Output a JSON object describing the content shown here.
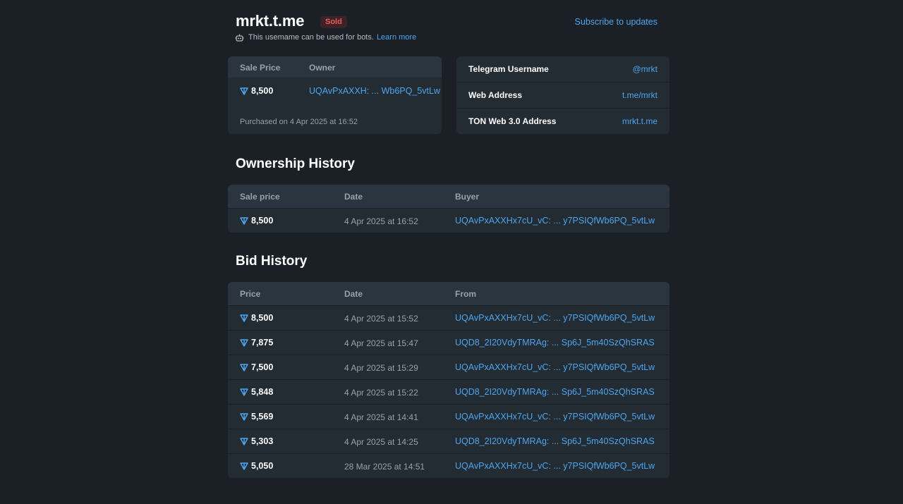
{
  "header": {
    "title": "mrkt.t.me",
    "status_badge": "Sold",
    "subscribe_label": "Subscribe to updates",
    "bot_note": "This usemame can be used for bots.",
    "learn_more": "Learn more"
  },
  "sale_card": {
    "price_header": "Sale Price",
    "owner_header": "Owner",
    "price": "8,500",
    "owner": "UQAvPxAXXH: ... Wb6PQ_5vtLw",
    "purchased": "Purchased on 4 Apr 2025 at 16:52"
  },
  "info_card": {
    "rows": [
      {
        "label": "Telegram Username",
        "value": "@mrkt"
      },
      {
        "label": "Web Address",
        "value": "t.me/mrkt"
      },
      {
        "label": "TON Web 3.0 Address",
        "value": "mrkt.t.me"
      }
    ]
  },
  "ownership": {
    "title": "Ownership History",
    "headers": [
      "Sale price",
      "Date",
      "Buyer"
    ],
    "rows": [
      {
        "price": "8,500",
        "date": "4 Apr 2025 at 16:52",
        "address": "UQAvPxAXXHx7cU_vC: ... y7PSIQfWb6PQ_5vtLw"
      }
    ]
  },
  "bids": {
    "title": "Bid History",
    "headers": [
      "Price",
      "Date",
      "From"
    ],
    "rows": [
      {
        "price": "8,500",
        "date": "4 Apr 2025 at 15:52",
        "address": "UQAvPxAXXHx7cU_vC: ... y7PSIQfWb6PQ_5vtLw"
      },
      {
        "price": "7,875",
        "date": "4 Apr 2025 at 15:47",
        "address": "UQD8_2I20VdyTMRAg: ... Sp6J_5m40SzQhSRAS"
      },
      {
        "price": "7,500",
        "date": "4 Apr 2025 at 15:29",
        "address": "UQAvPxAXXHx7cU_vC: ... y7PSIQfWb6PQ_5vtLw"
      },
      {
        "price": "5,848",
        "date": "4 Apr 2025 at 15:22",
        "address": "UQD8_2I20VdyTMRAg: ... Sp6J_5m40SzQhSRAS"
      },
      {
        "price": "5,569",
        "date": "4 Apr 2025 at 14:41",
        "address": "UQAvPxAXXHx7cU_vC: ... y7PSIQfWb6PQ_5vtLw"
      },
      {
        "price": "5,303",
        "date": "4 Apr 2025 at 14:25",
        "address": "UQD8_2I20VdyTMRAg: ... Sp6J_5m40SzQhSRAS"
      },
      {
        "price": "5,050",
        "date": "28 Mar 2025 at 14:51",
        "address": "UQAvPxAXXHx7cU_vC: ... y7PSIQfWb6PQ_5vtLw"
      }
    ]
  },
  "colors": {
    "background": "#1a2026",
    "card": "#232b33",
    "card_header": "#2b3540",
    "link": "#4ea6ee",
    "sold_badge": "#ef5b5b"
  },
  "icons": {
    "currency": "ton-diamond-icon",
    "bot": "bot-icon"
  }
}
